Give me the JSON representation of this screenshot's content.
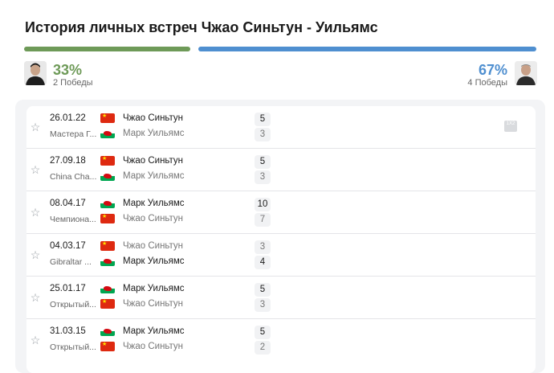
{
  "title": "История личных встреч Чжао Синьтун - Уильямс",
  "left_player": {
    "percent": "33%",
    "wins": "2 Победы"
  },
  "right_player": {
    "percent": "67%",
    "wins": "4 Победы"
  },
  "colors": {
    "left_bar": "#6e9a58",
    "right_bar": "#4f8fd0"
  },
  "h2h_icon_label": "1X2",
  "matches": [
    {
      "date": "26.01.22",
      "tournament": "Мастера Г...",
      "top": {
        "flag": "cn",
        "name": "Чжао Синьтун",
        "score": "5",
        "winner": true
      },
      "bottom": {
        "flag": "wales",
        "name": "Марк Уильямс",
        "score": "3",
        "winner": false
      }
    },
    {
      "date": "27.09.18",
      "tournament": "China Cha...",
      "top": {
        "flag": "cn",
        "name": "Чжао Синьтун",
        "score": "5",
        "winner": true
      },
      "bottom": {
        "flag": "wales",
        "name": "Марк Уильямс",
        "score": "3",
        "winner": false
      }
    },
    {
      "date": "08.04.17",
      "tournament": "Чемпиона...",
      "top": {
        "flag": "wales",
        "name": "Марк Уильямс",
        "score": "10",
        "winner": true
      },
      "bottom": {
        "flag": "cn",
        "name": "Чжао Синьтун",
        "score": "7",
        "winner": false
      }
    },
    {
      "date": "04.03.17",
      "tournament": "Gibraltar ...",
      "top": {
        "flag": "cn",
        "name": "Чжао Синьтун",
        "score": "3",
        "winner": false
      },
      "bottom": {
        "flag": "wales",
        "name": "Марк Уильямс",
        "score": "4",
        "winner": true
      }
    },
    {
      "date": "25.01.17",
      "tournament": "Открытый...",
      "top": {
        "flag": "wales",
        "name": "Марк Уильямс",
        "score": "5",
        "winner": true
      },
      "bottom": {
        "flag": "cn",
        "name": "Чжао Синьтун",
        "score": "3",
        "winner": false
      }
    },
    {
      "date": "31.03.15",
      "tournament": "Открытый...",
      "top": {
        "flag": "wales",
        "name": "Марк Уильямс",
        "score": "5",
        "winner": true
      },
      "bottom": {
        "flag": "cn",
        "name": "Чжао Синьтун",
        "score": "2",
        "winner": false
      }
    }
  ]
}
